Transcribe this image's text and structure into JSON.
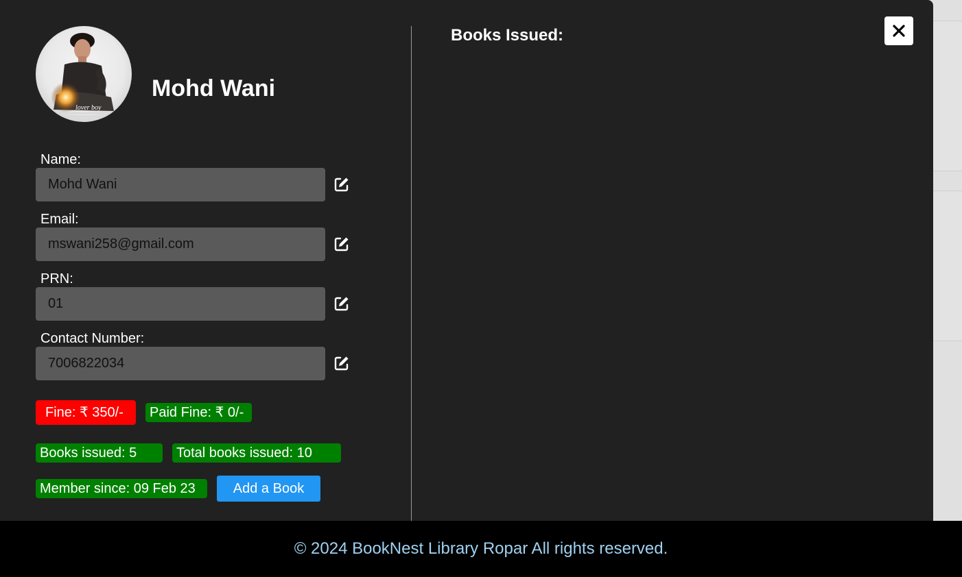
{
  "profile": {
    "name": "Mohd Wani",
    "avatar_caption": "lover boy"
  },
  "fields": [
    {
      "label": "Name:",
      "value": "Mohd Wani"
    },
    {
      "label": "Email:",
      "value": "mswani258@gmail.com"
    },
    {
      "label": "PRN:",
      "value": "01"
    },
    {
      "label": "Contact Number:",
      "value": "7006822034"
    }
  ],
  "stats": {
    "fine": "Fine: ₹ 350/-",
    "paid_fine": "Paid Fine: ₹ 0/-",
    "books_issued": "Books issued:  5",
    "total_books_issued": "Total books issued:  10",
    "member_since": "Member since: 09 Feb 23"
  },
  "actions": {
    "add_book_label": "Add a Book"
  },
  "books": {
    "title": "Books Issued:"
  },
  "footer": {
    "text": "© 2024 BookNest Library Ropar All rights reserved."
  },
  "colors": {
    "modal_bg": "#212121",
    "input_bg": "#5a5a5a",
    "fine_red": "#ff0000",
    "status_green": "#008000",
    "accent_blue": "#2196f3",
    "footer_text": "#9fd1f1"
  },
  "icons": {
    "close": "close-icon",
    "edit": "edit-icon"
  }
}
